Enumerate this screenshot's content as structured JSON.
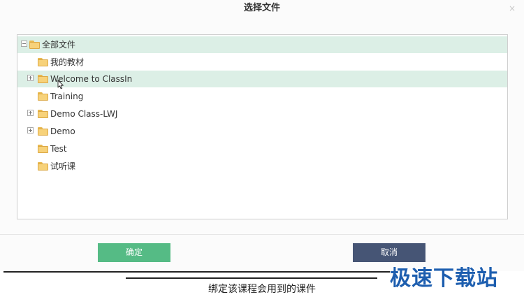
{
  "dialog": {
    "title": "选择文件",
    "close_glyph": "×"
  },
  "tree": {
    "items": [
      {
        "label": "全部文件",
        "toggle": "minus",
        "level": 0,
        "highlight": true
      },
      {
        "label": "我的教材",
        "toggle": "none",
        "level": 1,
        "highlight": false
      },
      {
        "label": "Welcome to ClassIn",
        "toggle": "plus",
        "level": 1,
        "highlight": true
      },
      {
        "label": "Training",
        "toggle": "none",
        "level": 1,
        "highlight": false
      },
      {
        "label": "Demo Class-LWJ",
        "toggle": "plus",
        "level": 1,
        "highlight": false
      },
      {
        "label": "Demo",
        "toggle": "plus",
        "level": 1,
        "highlight": false
      },
      {
        "label": "Test",
        "toggle": "none",
        "level": 1,
        "highlight": false
      },
      {
        "label": "试听课",
        "toggle": "none",
        "level": 1,
        "highlight": false
      }
    ]
  },
  "buttons": {
    "ok_label": "确定",
    "cancel_label": "取消"
  },
  "caption": {
    "text": "绑定该课程会用到的课件"
  },
  "watermark": {
    "text": "极速下载站"
  },
  "colors": {
    "ok": "#55bb85",
    "cancel": "#465575",
    "highlight": "#dcefe6",
    "folder": "#f7d27a",
    "watermark": "#1d5eaf"
  }
}
